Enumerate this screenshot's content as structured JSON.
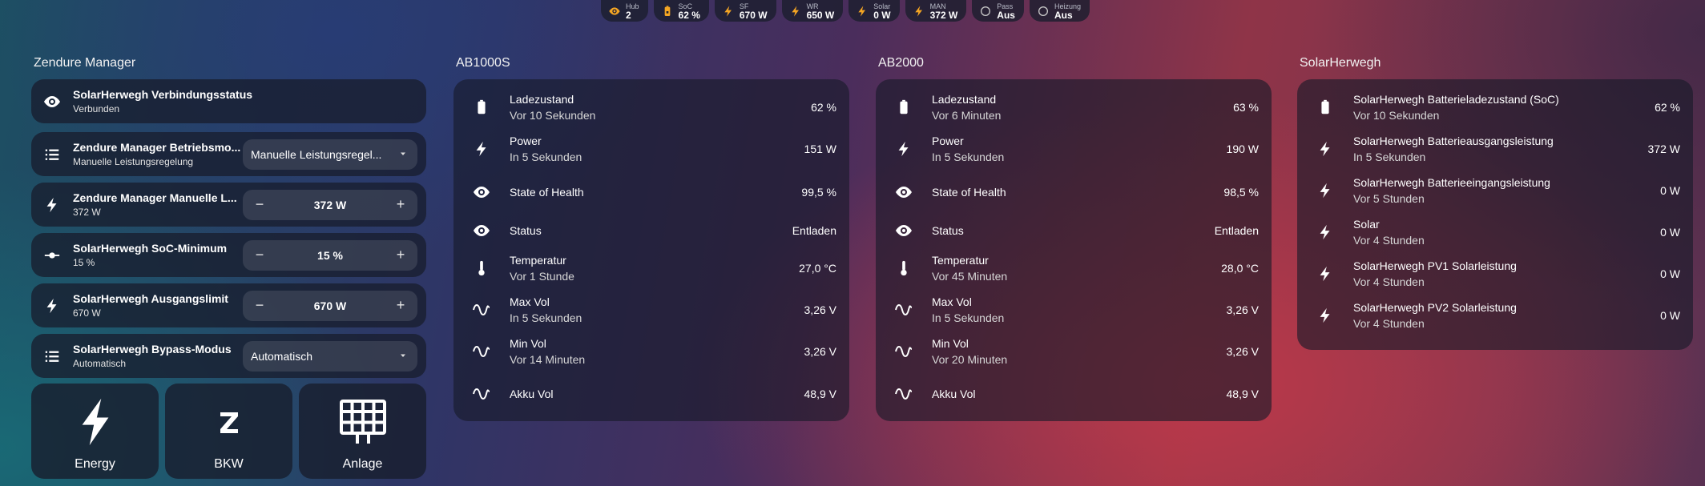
{
  "chips": [
    {
      "label": "Hub",
      "value": "2",
      "icon": "eye-icon"
    },
    {
      "label": "SoC",
      "value": "62 %",
      "icon": "battery-lock-icon"
    },
    {
      "label": "SF",
      "value": "670 W",
      "icon": "bolt-icon"
    },
    {
      "label": "WR",
      "value": "650 W",
      "icon": "bolt-icon"
    },
    {
      "label": "Solar",
      "value": "0 W",
      "icon": "bolt-icon"
    },
    {
      "label": "MAN",
      "value": "372 W",
      "icon": "bolt-icon"
    },
    {
      "label": "Pass",
      "value": "Aus",
      "icon": "circle-icon"
    },
    {
      "label": "Heizung",
      "value": "Aus",
      "icon": "circle-icon"
    }
  ],
  "colors": {
    "accent": "#f5a623",
    "card": "#181e2e"
  },
  "manager": {
    "title": "Zendure Manager",
    "rows": [
      {
        "name": "SolarHerwegh Verbindungsstatus",
        "sub": "Verbunden",
        "icon": "eye-icon"
      },
      {
        "name": "Zendure Manager Betriebsmo...",
        "sub": "Manuelle Leistungsregelung",
        "icon": "list-icon",
        "select": "Manuelle Leistungsregel..."
      },
      {
        "name": "Zendure Manager Manuelle L...",
        "sub": "372 W",
        "icon": "bolt-icon",
        "number": "372 W"
      },
      {
        "name": "SolarHerwegh SoC-Minimum",
        "sub": "15 %",
        "icon": "slider-icon",
        "number": "15 %"
      },
      {
        "name": "SolarHerwegh Ausgangslimit",
        "sub": "670 W",
        "icon": "bolt-icon",
        "number": "670 W"
      },
      {
        "name": "SolarHerwegh Bypass-Modus",
        "sub": "Automatisch",
        "icon": "list-icon",
        "select": "Automatisch"
      }
    ],
    "minus": "−",
    "plus": "+",
    "tiles": [
      {
        "label": "Energy",
        "icon": "bolt-icon"
      },
      {
        "label": "BKW",
        "icon": "zendure-z-icon"
      },
      {
        "label": "Anlage",
        "icon": "solar-panel-icon"
      }
    ]
  },
  "ab1000s": {
    "title": "AB1000S",
    "entities": [
      {
        "name": "Ladezustand",
        "sub": "Vor 10 Sekunden",
        "value": "62 %",
        "icon": "battery-icon"
      },
      {
        "name": "Power",
        "sub": "In 5 Sekunden",
        "value": "151 W",
        "icon": "bolt-icon"
      },
      {
        "name": "State of Health",
        "sub": "",
        "value": "99,5 %",
        "icon": "eye-icon"
      },
      {
        "name": "Status",
        "sub": "",
        "value": "Entladen",
        "icon": "eye-icon"
      },
      {
        "name": "Temperatur",
        "sub": "Vor 1 Stunde",
        "value": "27,0 °C",
        "icon": "thermometer-icon"
      },
      {
        "name": "Max Vol",
        "sub": "In 5 Sekunden",
        "value": "3,26 V",
        "icon": "sine-wave-icon"
      },
      {
        "name": "Min Vol",
        "sub": "Vor 14 Minuten",
        "value": "3,26 V",
        "icon": "sine-wave-icon"
      },
      {
        "name": "Akku Vol",
        "sub": "",
        "value": "48,9 V",
        "icon": "sine-wave-icon"
      }
    ]
  },
  "ab2000": {
    "title": "AB2000",
    "entities": [
      {
        "name": "Ladezustand",
        "sub": "Vor 6 Minuten",
        "value": "63 %",
        "icon": "battery-icon"
      },
      {
        "name": "Power",
        "sub": "In 5 Sekunden",
        "value": "190 W",
        "icon": "bolt-icon"
      },
      {
        "name": "State of Health",
        "sub": "",
        "value": "98,5 %",
        "icon": "eye-icon"
      },
      {
        "name": "Status",
        "sub": "",
        "value": "Entladen",
        "icon": "eye-icon"
      },
      {
        "name": "Temperatur",
        "sub": "Vor 45 Minuten",
        "value": "28,0 °C",
        "icon": "thermometer-icon"
      },
      {
        "name": "Max Vol",
        "sub": "In 5 Sekunden",
        "value": "3,26 V",
        "icon": "sine-wave-icon"
      },
      {
        "name": "Min Vol",
        "sub": "Vor 20 Minuten",
        "value": "3,26 V",
        "icon": "sine-wave-icon"
      },
      {
        "name": "Akku Vol",
        "sub": "",
        "value": "48,9 V",
        "icon": "sine-wave-icon"
      }
    ]
  },
  "solarherwegh": {
    "title": "SolarHerwegh",
    "entities": [
      {
        "name": "SolarHerwegh Batterieladezustand (SoC)",
        "sub": "Vor 10 Sekunden",
        "value": "62 %",
        "icon": "battery-icon"
      },
      {
        "name": "SolarHerwegh Batterieausgangsleistung",
        "sub": "In 5 Sekunden",
        "value": "372 W",
        "icon": "bolt-icon"
      },
      {
        "name": "SolarHerwegh Batterieeingangsleistung",
        "sub": "Vor 5 Stunden",
        "value": "0 W",
        "icon": "bolt-icon"
      },
      {
        "name": "Solar",
        "sub": "Vor 4 Stunden",
        "value": "0 W",
        "icon": "bolt-icon"
      },
      {
        "name": "SolarHerwegh PV1 Solarleistung",
        "sub": "Vor 4 Stunden",
        "value": "0 W",
        "icon": "bolt-icon"
      },
      {
        "name": "SolarHerwegh PV2 Solarleistung",
        "sub": "Vor 4 Stunden",
        "value": "0 W",
        "icon": "bolt-icon"
      }
    ]
  }
}
